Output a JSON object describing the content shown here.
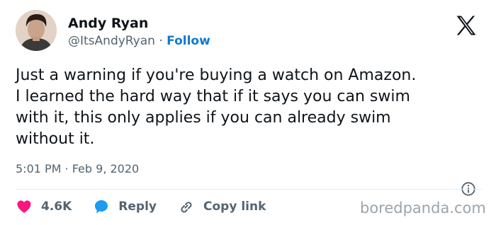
{
  "author": {
    "name": "Andy Ryan",
    "handle": "@ItsAndyRyan",
    "separator": "·",
    "follow_label": "Follow"
  },
  "platform_icon": "x-logo-icon",
  "tweet": {
    "lines": [
      "Just a warning if you're buying a watch on Amazon.",
      "I learned the hard way that if it says you can swim",
      "with it, this only applies if you can already swim",
      "without it."
    ],
    "timestamp": "5:01 PM · Feb 9, 2020"
  },
  "actions": {
    "likes": {
      "icon": "heart-icon",
      "label": "4.6K",
      "color": "#f91880"
    },
    "reply": {
      "icon": "speech-bubble-icon",
      "label": "Reply",
      "color": "#1d9bf0"
    },
    "copy": {
      "icon": "link-icon",
      "label": "Copy link"
    }
  },
  "watermark": "boredpanda.com"
}
